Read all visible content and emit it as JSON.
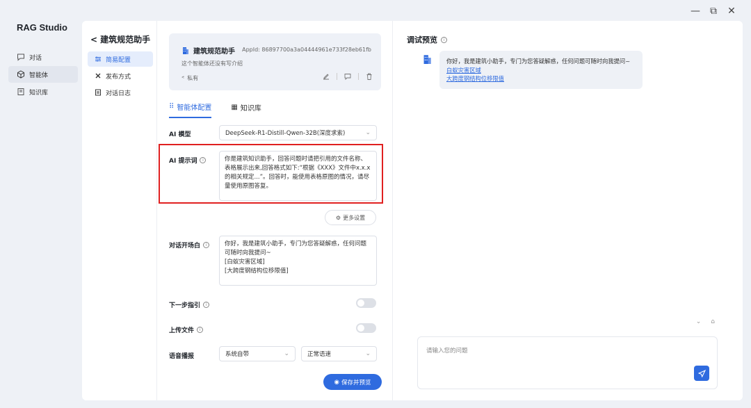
{
  "window": {
    "minimize": "—",
    "maximize": "⧉",
    "close": "✕"
  },
  "app": {
    "title": "RAG Studio"
  },
  "nav": {
    "items": [
      {
        "label": "对话",
        "icon": "chat-icon"
      },
      {
        "label": "智能体",
        "icon": "cube-icon",
        "active": true
      },
      {
        "label": "知识库",
        "icon": "book-icon"
      }
    ]
  },
  "subnav": {
    "back_title": "建筑规范助手",
    "items": [
      {
        "label": "简易配置",
        "icon": "sliders-icon",
        "active": true
      },
      {
        "label": "发布方式",
        "icon": "share-icon"
      },
      {
        "label": "对话日志",
        "icon": "log-icon"
      }
    ]
  },
  "agent": {
    "name": "建筑规范助手",
    "appid": "AppId: 86897700a3a04444961e733f28eb61fb",
    "desc": "这个智能体还没有写介绍",
    "visibility": "私有"
  },
  "tabs": [
    {
      "label": "智能体配置",
      "active": true
    },
    {
      "label": "知识库"
    }
  ],
  "config": {
    "model_label": "AI 模型",
    "model_value": "DeepSeek-R1-Distill-Qwen-32B(深度求索)",
    "prompt_label": "AI 提示词",
    "prompt_value": "你是建筑知识助手，回答问题时请把引用的文件名称、表格展示出来,回答格式如下:“根据《XXX》文件中x.x.x的相关规定...”。回答时，能使用表格原图的情况，请尽量使用原图答复。",
    "more_settings": "更多设置",
    "opening_label": "对话开场白",
    "opening_value": "你好，我是建筑小助手，专门为您答疑解惑，任何问题可随时向我提问~\n[白蚁灾害区域]\n[大跨度钢结构位移限值]",
    "next_step_label": "下一步指引",
    "upload_label": "上传文件",
    "voice_label": "语音播报",
    "voice_source": "系统自带",
    "voice_speed": "正常语速",
    "save_preview": "保存并预览"
  },
  "preview": {
    "title": "调试预览",
    "greeting": "你好，我是建筑小助手，专门为您答疑解惑，任何问题可随时向我提问~",
    "links": [
      "白蚁灾害区域",
      "大跨度钢结构位移限值"
    ],
    "input_placeholder": "请输入您的问题"
  },
  "colors": {
    "accent": "#2f6bdf",
    "highlight_frame": "#e02020"
  }
}
